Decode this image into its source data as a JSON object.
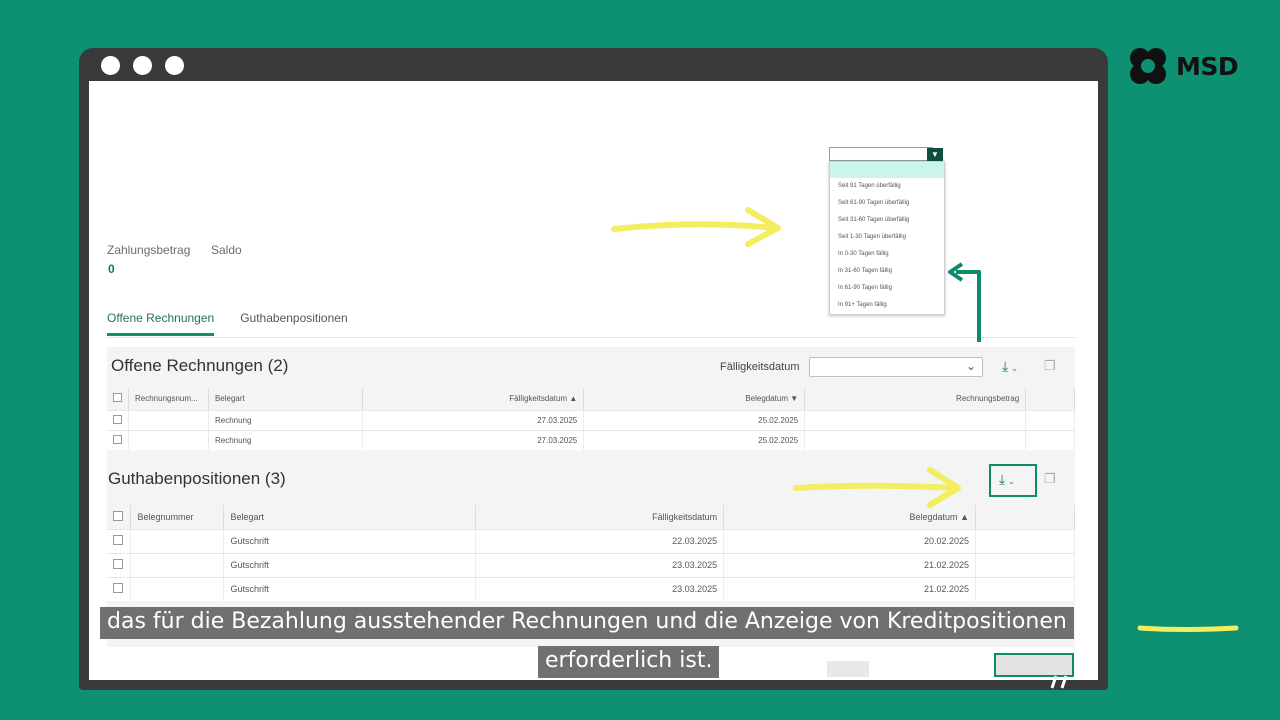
{
  "brand": {
    "name": "MSD",
    "color": "#0e9073"
  },
  "window": {
    "dots": 3
  },
  "summary": {
    "payment_label": "Zahlungsbetrag",
    "payment_value": "0",
    "balance_label": "Saldo"
  },
  "tabs": [
    {
      "label": "Offene Rechnungen",
      "active": true
    },
    {
      "label": "Guthabenpositionen",
      "active": false
    }
  ],
  "open_invoices": {
    "title": "Offene Rechnungen (2)",
    "filter_label": "Fälligkeitsdatum",
    "filter_value": "",
    "columns": [
      "Rechnungsnum...",
      "Belegart",
      "Fälligkeitsdatum",
      "Belegdatum",
      "Rechnungsbetrag"
    ],
    "rows": [
      {
        "number": "",
        "type": "Rechnung",
        "due": "27.03.2025",
        "doc_date": "25.02.2025",
        "amount": ""
      },
      {
        "number": "",
        "type": "Rechnung",
        "due": "27.03.2025",
        "doc_date": "25.02.2025",
        "amount": ""
      }
    ]
  },
  "credits": {
    "title": "Guthabenpositionen (3)",
    "columns": [
      "Belegnummer",
      "Belegart",
      "Fälligkeitsdatum",
      "Belegdatum"
    ],
    "rows": [
      {
        "number": "",
        "type": "Gutschrift",
        "due": "22.03.2025",
        "doc_date": "20.02.2025"
      },
      {
        "number": "",
        "type": "Gutschrift",
        "due": "23.03.2025",
        "doc_date": "21.02.2025"
      },
      {
        "number": "",
        "type": "Gutschrift",
        "due": "23.03.2025",
        "doc_date": "21.02.2025"
      }
    ]
  },
  "dropdown": {
    "options": [
      "Seit 91 Tagen überfällig",
      "Seit 61-90 Tagen überfällig",
      "Seit 31-60 Tagen überfällig",
      "Seit 1-30 Tagen überfällig",
      "In 0-30 Tagen fällig",
      "In 31-60 Tagen fällig",
      "In 61-90 Tagen fällig",
      "In 91+ Tagen fällig"
    ]
  },
  "caption": {
    "line1": "das für die Bezahlung ausstehender Rechnungen und die Anzeige von Kreditpositionen",
    "line2": "erforderlich ist."
  },
  "annotation_colors": {
    "arrow_yellow": "#f3ee60",
    "arrow_green": "#0e8a6c"
  }
}
